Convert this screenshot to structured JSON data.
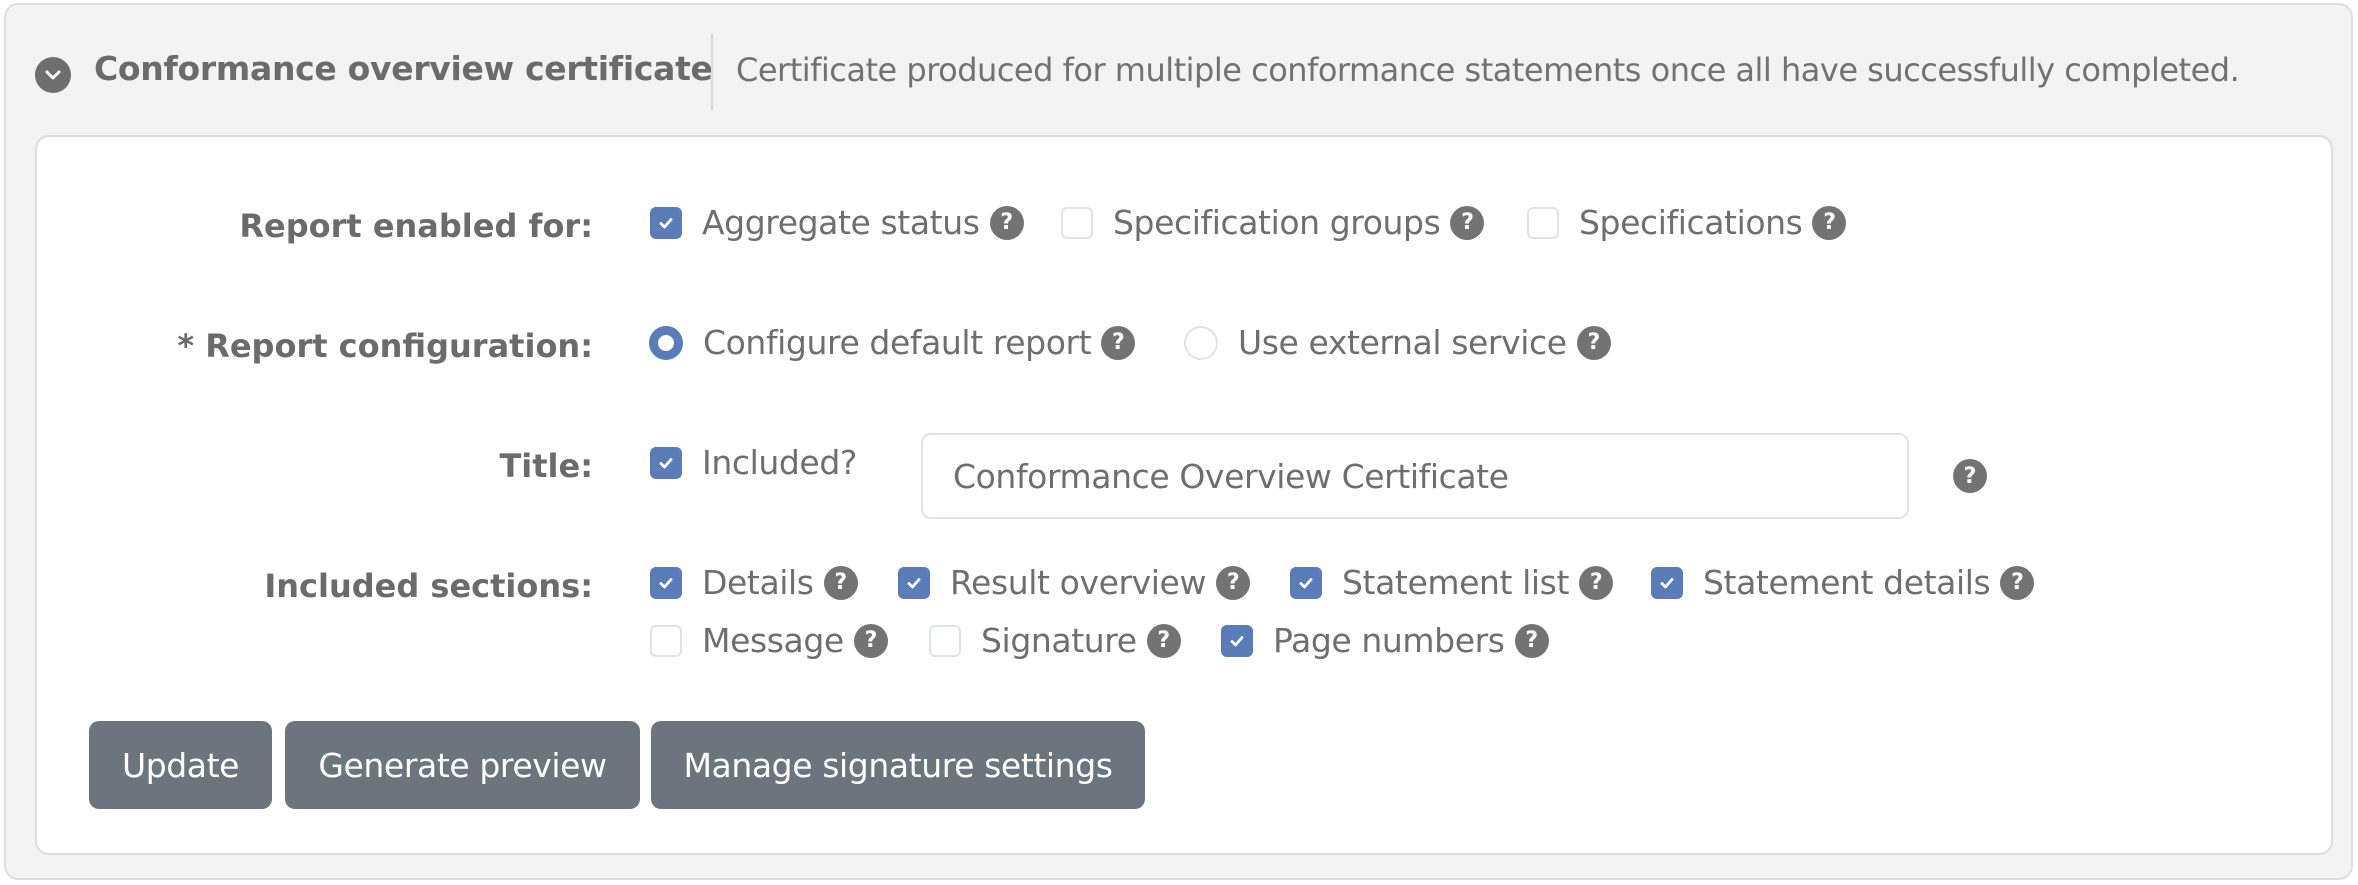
{
  "panel": {
    "title": "Conformance overview certificate",
    "description": "Certificate produced for multiple conformance statements once all have successfully completed.",
    "expand_icon": "chevron-down-circle-icon"
  },
  "form": {
    "report_enabled_for": {
      "label": "Report enabled for:",
      "options": [
        {
          "label": "Aggregate status",
          "checked": true
        },
        {
          "label": "Specification groups",
          "checked": false
        },
        {
          "label": "Specifications",
          "checked": false
        }
      ]
    },
    "report_configuration": {
      "label": "* Report configuration:",
      "options": [
        {
          "label": "Configure default report",
          "selected": true
        },
        {
          "label": "Use external service",
          "selected": false
        }
      ]
    },
    "title": {
      "label": "Title:",
      "included_label": "Included?",
      "included": true,
      "value": "Conformance Overview Certificate"
    },
    "included_sections": {
      "label": "Included sections:",
      "options": [
        {
          "label": "Details",
          "checked": true
        },
        {
          "label": "Result overview",
          "checked": true
        },
        {
          "label": "Statement list",
          "checked": true
        },
        {
          "label": "Statement details",
          "checked": true
        },
        {
          "label": "Message",
          "checked": false
        },
        {
          "label": "Signature",
          "checked": false
        },
        {
          "label": "Page numbers",
          "checked": true
        }
      ]
    },
    "help_glyph": "?"
  },
  "buttons": {
    "update": "Update",
    "generate_preview": "Generate preview",
    "manage_signature": "Manage signature settings"
  },
  "colors": {
    "accent": "#5a7cb8",
    "button": "#6c757d",
    "help_icon": "#737373"
  }
}
